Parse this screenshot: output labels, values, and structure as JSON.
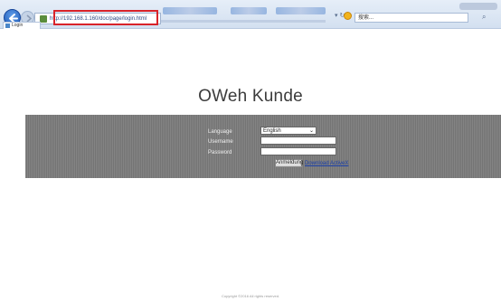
{
  "browser": {
    "url": "http://192.168.1.160/doc/page/login.html",
    "tab_title": "Login",
    "search_placeholder": "搜索...",
    "refresh_separator": "▾ ↻"
  },
  "page": {
    "brand": "OWeh Kunde",
    "form": {
      "language_label": "Language",
      "language_value": "English",
      "username_label": "Username",
      "password_label": "Password",
      "login_button": "Anmeldung",
      "download_link": "Download ActiveX"
    },
    "footer": "Copyright ©2016  All rights reserved."
  },
  "colors": {
    "band": "#7b7b7b",
    "highlight": "#d8232a",
    "link": "#1a3fa8"
  }
}
